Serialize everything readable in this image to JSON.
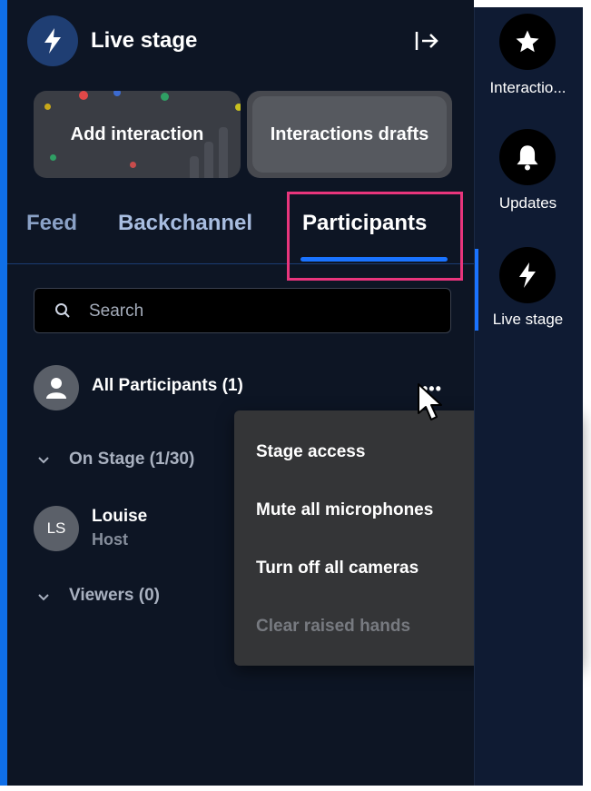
{
  "header": {
    "title": "Live stage",
    "icon": "bolt-icon",
    "exit_icon": "exit-icon"
  },
  "actions": {
    "add_interaction": "Add interaction",
    "interactions_drafts": "Interactions drafts"
  },
  "tabs": [
    {
      "label": "Feed"
    },
    {
      "label": "Backchannel"
    },
    {
      "label": "Participants",
      "active": true
    }
  ],
  "search": {
    "placeholder": "Search"
  },
  "participants": {
    "all_label": "All Participants (1)",
    "on_stage_label": "On Stage (1/30)",
    "viewers_label": "Viewers (0)",
    "people": [
      {
        "initials": "LS",
        "name": "Louise",
        "role": "Host"
      }
    ]
  },
  "context_menu": {
    "items": [
      {
        "label": "Stage access",
        "has_submenu": true
      },
      {
        "label": "Mute all microphones"
      },
      {
        "label": "Turn off all cameras"
      },
      {
        "label": "Clear raised hands",
        "disabled": true
      }
    ]
  },
  "rail": {
    "items": [
      {
        "label": "Interactio...",
        "icon": "star-icon"
      },
      {
        "label": "Updates",
        "icon": "bell-icon"
      },
      {
        "label": "Live stage",
        "icon": "bolt-icon",
        "active": true
      }
    ]
  },
  "colors": {
    "panel_bg": "#0d1524",
    "rail_bg": "#0f1b33",
    "accent": "#1a73ff",
    "highlight": "#e8357c",
    "menu_bg": "#343537"
  }
}
